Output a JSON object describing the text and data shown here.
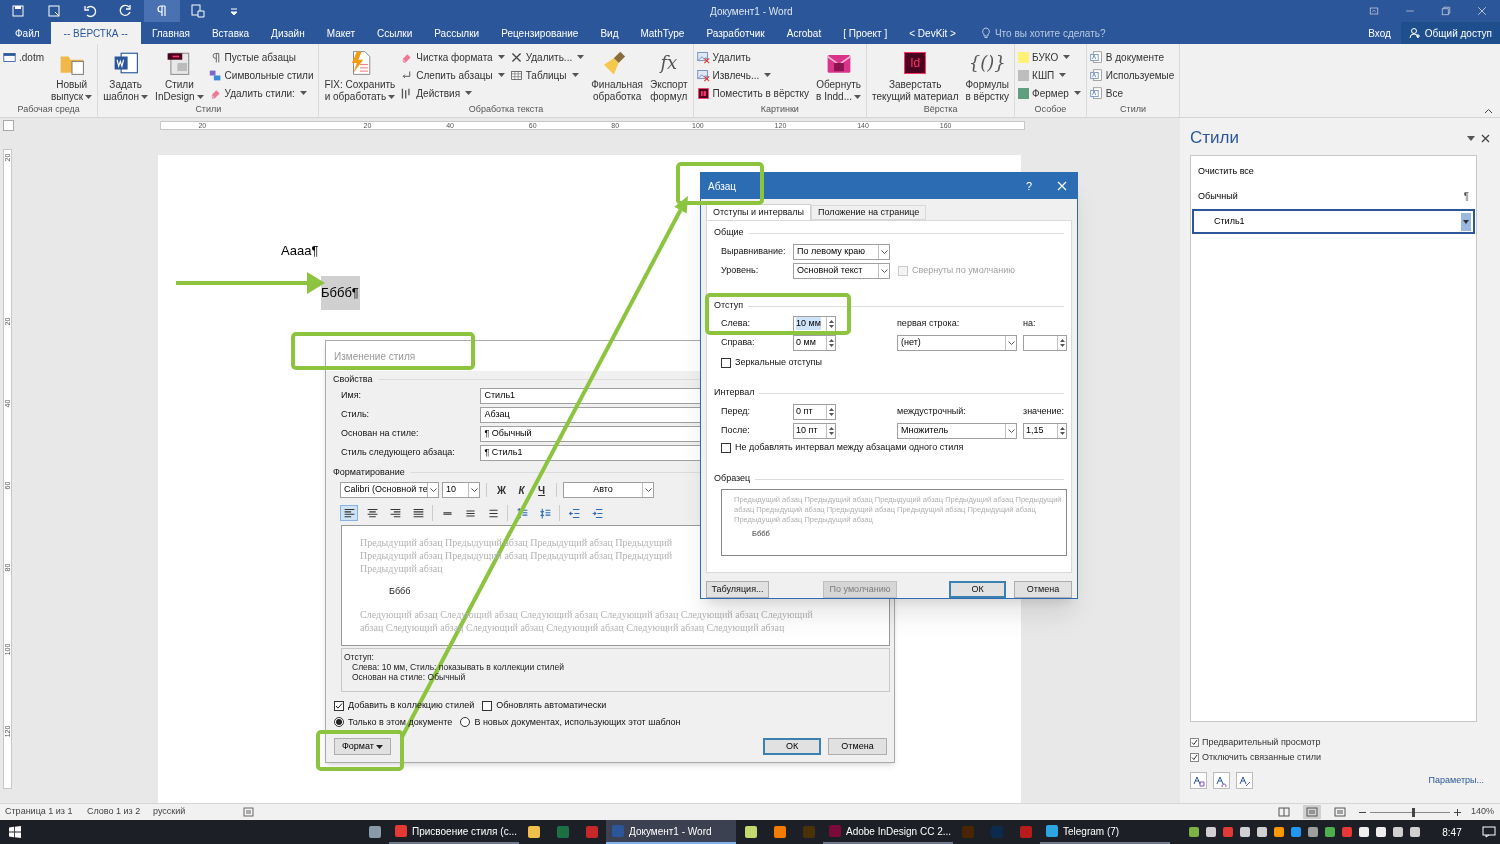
{
  "window": {
    "title": "Документ1 - Word"
  },
  "ribbon_tabs": [
    {
      "label": "Файл",
      "selected": false
    },
    {
      "label": "-- ВЁРСТКА --",
      "selected": true
    },
    {
      "label": "Главная",
      "selected": false
    },
    {
      "label": "Вставка",
      "selected": false
    },
    {
      "label": "Дизайн",
      "selected": false
    },
    {
      "label": "Макет",
      "selected": false
    },
    {
      "label": "Ссылки",
      "selected": false
    },
    {
      "label": "Рассылки",
      "selected": false
    },
    {
      "label": "Рецензирование",
      "selected": false
    },
    {
      "label": "Вид",
      "selected": false
    },
    {
      "label": "MathType",
      "selected": false
    },
    {
      "label": "Разработчик",
      "selected": false
    },
    {
      "label": "Acrobat",
      "selected": false
    },
    {
      "label": "[ Проект ]",
      "selected": false
    },
    {
      "label": "< DevKit >",
      "selected": false
    }
  ],
  "tell_me": {
    "placeholder": "Что вы хотите сделать?"
  },
  "sign_in": "Вход",
  "share": "Общий доступ",
  "ribbon_groups": [
    {
      "label": "Рабочая среда",
      "controls": [
        {
          "kind": "stack",
          "items": [
            {
              "label": ".dotm",
              "dropdown": false
            }
          ]
        },
        {
          "kind": "large",
          "label": "Новый\nвыпуск",
          "dropdown": true
        }
      ]
    },
    {
      "label": "Стили",
      "controls": [
        {
          "kind": "large",
          "label": "Задать\nшаблон",
          "dropdown": true
        },
        {
          "kind": "large",
          "label": "Стили\nInDesign",
          "dropdown": true
        },
        {
          "kind": "stack",
          "items": [
            {
              "label": "Пустые абзацы",
              "dropdown": false
            },
            {
              "label": "Символьные стили",
              "dropdown": false
            },
            {
              "label": "Удалить стили:",
              "dropdown": true
            }
          ]
        }
      ]
    },
    {
      "label": "Обработка текста",
      "controls": [
        {
          "kind": "large",
          "label": "FIX: Сохранить\nи обработать",
          "dropdown": true
        },
        {
          "kind": "stack",
          "items": [
            {
              "label": "Чистка формата",
              "dropdown": true
            },
            {
              "label": "Слепить абзацы",
              "dropdown": true
            },
            {
              "label": "Действия",
              "dropdown": true
            }
          ]
        },
        {
          "kind": "stack",
          "items": [
            {
              "label": "Удалить...",
              "dropdown": true
            },
            {
              "label": "Таблицы",
              "dropdown": true
            }
          ]
        },
        {
          "kind": "large",
          "label": "Финальная\nобработка",
          "dropdown": false
        },
        {
          "kind": "large",
          "label": "Экспорт\nформул",
          "glyph": "fx",
          "dropdown": false
        }
      ]
    },
    {
      "label": "Картинки",
      "controls": [
        {
          "kind": "stack",
          "items": [
            {
              "label": "Удалить",
              "dropdown": false
            },
            {
              "label": "Извлечь...",
              "dropdown": true
            },
            {
              "label": "Поместить в вёрстку",
              "dropdown": false
            }
          ]
        },
        {
          "kind": "large",
          "label": "Обернуть\nв Indd...",
          "dropdown": true
        }
      ]
    },
    {
      "label": "Вёрстка",
      "controls": [
        {
          "kind": "large",
          "label": "Заверстать\nтекущий материал",
          "glyph": "Id",
          "dropdown": false
        },
        {
          "kind": "large",
          "label": "Формулы\nв вёрстку",
          "glyph": "{()}",
          "dropdown": false
        }
      ]
    },
    {
      "label": "Особое",
      "controls": [
        {
          "kind": "stack",
          "items": [
            {
              "label": "БУКО",
              "color": "#fff176",
              "dropdown": true
            },
            {
              "label": "КШП",
              "color": "#bdbdbd",
              "dropdown": true
            },
            {
              "label": "Фермер",
              "color": "#5f9e7f",
              "dropdown": true
            }
          ]
        }
      ]
    },
    {
      "label": "Стили",
      "controls": [
        {
          "kind": "stack",
          "items": [
            {
              "label": "В документе",
              "dropdown": false
            },
            {
              "label": "Используемые",
              "dropdown": false
            },
            {
              "label": "Все",
              "dropdown": false
            }
          ]
        }
      ]
    }
  ],
  "ruler": {
    "labels": [
      "20",
      "20",
      "40",
      "60",
      "80",
      "100",
      "120",
      "140",
      "160"
    ]
  },
  "vertical_ruler": {
    "labels": [
      "20",
      "20",
      "40",
      "60",
      "80",
      "100",
      "120"
    ]
  },
  "document": {
    "paragraphs": [
      {
        "text": "Аааа¶",
        "selected": false
      },
      {
        "text": "Бббб¶",
        "selected": true
      }
    ]
  },
  "styles_pane": {
    "title": "Стили",
    "items": [
      {
        "label": "Очистить все",
        "selected": false
      },
      {
        "label": "Обычный",
        "mark": "¶",
        "selected": false
      },
      {
        "label": "Стиль1",
        "selected": true
      }
    ],
    "options": [
      {
        "label": "Предварительный просмотр",
        "checked": true
      },
      {
        "label": "Отключить связанные стили",
        "checked": true
      }
    ],
    "link": "Параметры..."
  },
  "modify_style_dialog": {
    "title": "Изменение стиля",
    "properties_header": "Свойства",
    "fields": [
      {
        "label": "Имя:",
        "value": "Стиль1"
      },
      {
        "label": "Стиль:",
        "value": "Абзац"
      },
      {
        "label": "Основан на стиле:",
        "value": "¶ Обычный"
      },
      {
        "label": "Стиль следующего абзаца:",
        "value": "¶ Стиль1"
      }
    ],
    "formatting_header": "Форматирование",
    "font": "Calibri (Основной те",
    "size": "10",
    "format_buttons": [
      {
        "label": "Ж",
        "kind": "bold"
      },
      {
        "label": "К",
        "kind": "italic"
      },
      {
        "label": "Ч",
        "kind": "underline"
      }
    ],
    "text_color": "Авто",
    "toolbar": [
      {
        "kind": "align-left",
        "selected": true
      },
      {
        "kind": "align-center",
        "selected": false
      },
      {
        "kind": "align-right",
        "selected": false
      },
      {
        "kind": "justify",
        "selected": false
      },
      {
        "kind": "single",
        "selected": false
      },
      {
        "kind": "one-half",
        "selected": false
      },
      {
        "kind": "double",
        "selected": false
      },
      {
        "kind": "space-up",
        "selected": false
      },
      {
        "kind": "space-down",
        "selected": false
      },
      {
        "kind": "outdent",
        "selected": false
      },
      {
        "kind": "indent",
        "selected": false
      }
    ],
    "preview": {
      "before": [
        "Предыдущий абзац Предыдущий абзац Предыдущий абзац Предыдущий",
        "Предыдущий абзац Предыдущий абзац Предыдущий абзац Предыдущий",
        "Предыдущий абзац"
      ],
      "sample": "Бббб",
      "after": [
        "Следующий абзац Следующий абзац Следующий абзац Следующий абзац Следующий абзац Следующий",
        "абзац Следующий абзац Следующий абзац Следующий абзац Следующий абзац Следующий абзац"
      ]
    },
    "description": [
      "Отступ:",
      "Слева: 10 мм, Стиль: показывать в коллекции стилей",
      "Основан на стиле: Обычный"
    ],
    "checkboxes": [
      {
        "label": "Добавить в коллекцию стилей",
        "checked": true
      },
      {
        "label": "Обновлять автоматически",
        "checked": false
      }
    ],
    "radios": [
      {
        "label": "Только в этом документе",
        "selected": true
      },
      {
        "label": "В новых документах, использующих этот шаблон",
        "selected": false
      }
    ],
    "format_button": "Формат",
    "ok": "ОК",
    "cancel": "Отмена"
  },
  "paragraph_dialog": {
    "title": "Абзац",
    "help": "?",
    "tabs": [
      {
        "label": "Отступы и интервалы",
        "selected": true
      },
      {
        "label": "Положение на странице",
        "selected": false
      }
    ],
    "general": {
      "header": "Общие",
      "alignment": {
        "label": "Выравнивание:",
        "value": "По левому краю"
      },
      "level": {
        "label": "Уровень:",
        "value": "Основной текст"
      },
      "collapsed": {
        "label": "Свернуты по умолчанию",
        "checked": false,
        "disabled": true
      }
    },
    "indent": {
      "header": "Отступ",
      "left": {
        "label": "Слева:",
        "value": "10 мм",
        "selected": true
      },
      "right": {
        "label": "Справа:",
        "value": "0 мм",
        "selected": false
      },
      "first_line": {
        "label": "первая строка:",
        "value": "(нет)"
      },
      "by": {
        "label": "на:"
      },
      "mirror": {
        "label": "Зеркальные отступы",
        "checked": false
      }
    },
    "spacing": {
      "header": "Интервал",
      "before": {
        "label": "Перед:",
        "value": "0 пт",
        "selected": false
      },
      "after": {
        "label": "После:",
        "value": "10 пт",
        "selected": false
      },
      "line": {
        "label": "междустрочный:",
        "value": "Множитель"
      },
      "at": {
        "label": "значение:",
        "value": "1,15",
        "selected": false
      },
      "dont_add": {
        "label": "Не добавлять интервал между абзацами одного стиля",
        "checked": false
      }
    },
    "sample": {
      "header": "Образец",
      "before": [
        "Предыдущий абзац Предыдущий абзац Предыдущий абзац Предыдущий абзац Предыдущий",
        "абзац Предыдущий абзац Предыдущий абзац Предыдущий абзац Предыдущий абзац",
        "Предыдущий абзац Предыдущий абзац"
      ],
      "text": "Бббб"
    },
    "buttons": [
      {
        "label": "Табуляция...",
        "disabled": false,
        "default": false
      },
      {
        "label": "По умолчанию",
        "disabled": true,
        "default": false
      },
      {
        "label": "ОК",
        "disabled": false,
        "default": true
      },
      {
        "label": "Отмена",
        "disabled": false,
        "default": false
      }
    ]
  },
  "status_bar": {
    "items": [
      "Страница 1 из 1",
      "Слово 1 из 2",
      "русский"
    ],
    "zoom": {
      "level": 0.55
    },
    "zoom_text": "140%"
  },
  "taskbar": {
    "items": [
      {
        "kind": "icon",
        "color": "#8a9aa8"
      },
      {
        "kind": "app",
        "label": "Присвоение стиля (с...",
        "color": "#e53935",
        "active": false
      },
      {
        "kind": "icon",
        "color": "#f0c04a"
      },
      {
        "kind": "icon",
        "color": "#1d7044"
      },
      {
        "kind": "icon",
        "color": "#c62828"
      },
      {
        "kind": "app",
        "label": "Документ1 - Word",
        "color": "#2b579a",
        "active": true
      },
      {
        "kind": "icon",
        "color": "#c5d86d"
      },
      {
        "kind": "icon",
        "color": "#f57c00"
      },
      {
        "kind": "icon",
        "color": "#4a3206"
      },
      {
        "kind": "app",
        "label": "Adobe InDesign CC 2...",
        "color": "#7a0a3a",
        "active": false
      },
      {
        "kind": "icon",
        "color": "#4a2600"
      },
      {
        "kind": "icon",
        "color": "#0b2a4d"
      },
      {
        "kind": "icon",
        "color": "#b71c1c"
      },
      {
        "kind": "app",
        "label": "Telegram (7)",
        "color": "#2ca5e0",
        "active": false
      }
    ],
    "tray": [
      {
        "color": "#7cb342"
      },
      {
        "color": "#d0d0d0"
      },
      {
        "color": "#e53935"
      },
      {
        "color": "#d0d0d0"
      },
      {
        "color": "#d0d0d0"
      },
      {
        "color": "#ff9800"
      },
      {
        "color": "#2196f3"
      },
      {
        "color": "#9e9e9e"
      },
      {
        "color": "#4caf50"
      },
      {
        "color": "#e53935"
      },
      {
        "color": "#eeeeee"
      },
      {
        "color": "#eeeeee"
      },
      {
        "color": "#d0d0d0"
      },
      {
        "color": "#d0d0d0"
      }
    ],
    "time": "8:47"
  }
}
